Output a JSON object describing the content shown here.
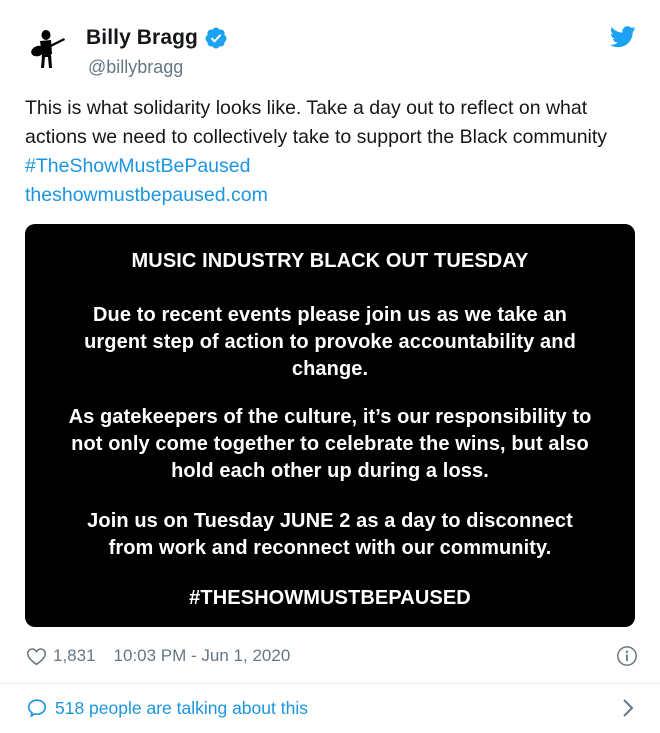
{
  "author": {
    "display_name": "Billy Bragg",
    "handle": "@billybragg",
    "verified_icon": "verified-badge-icon",
    "avatar_icon": "guitarist-silhouette-avatar"
  },
  "tweet": {
    "text_plain": "This is what solidarity looks like. Take a day out to reflect on what actions we need to collectively take to support the Black community ",
    "hashtag": "#TheShowMustBePaused",
    "link": "theshowmustbepaused.com"
  },
  "media": {
    "title": "MUSIC INDUSTRY BLACK OUT TUESDAY",
    "paragraph1": [
      "Due to recent events please join us as we take an",
      "urgent step of action to provoke accountability and",
      "change."
    ],
    "paragraph2": [
      "As gatekeepers of the culture, it’s our responsibility to",
      "not only come together to celebrate the wins, but also",
      "hold each other up during a loss."
    ],
    "paragraph3": [
      "Join us on Tuesday JUNE 2 as a day to disconnect",
      "from work and reconnect with our community."
    ],
    "hashtag": "#THESHOWMUSTBEPAUSED",
    "background_color": "#000000",
    "text_color": "#ffffff"
  },
  "meta": {
    "like_count": "1,831",
    "timestamp": "10:03 PM - Jun 1, 2020"
  },
  "talking": {
    "label": "518 people are talking about this"
  },
  "colors": {
    "link": "#1b95e0",
    "secondary_text": "#657786",
    "twitter_blue": "#1da1f2"
  }
}
